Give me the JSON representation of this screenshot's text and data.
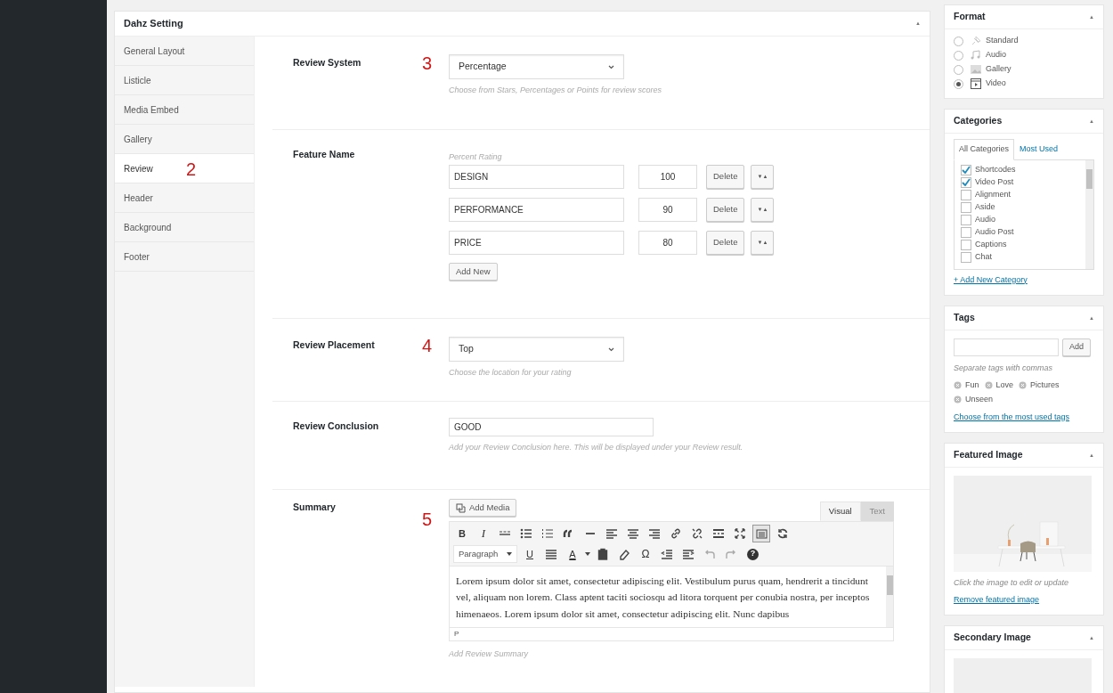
{
  "panel": {
    "title": "Dahz Setting",
    "collapse": "▲"
  },
  "tabs": [
    {
      "label": "General Layout",
      "selected": false
    },
    {
      "label": "Listicle",
      "selected": false
    },
    {
      "label": "Media Embed",
      "selected": false
    },
    {
      "label": "Gallery",
      "selected": false
    },
    {
      "label": "Review",
      "selected": true,
      "annotation": "2"
    },
    {
      "label": "Header",
      "selected": false
    },
    {
      "label": "Background",
      "selected": false
    },
    {
      "label": "Footer",
      "selected": false
    }
  ],
  "sections": [
    {
      "kind": "select",
      "label": "Review System",
      "annotation": "3",
      "value": "Percentage",
      "help": "Choose from Stars, Percentages or Points for review scores"
    },
    {
      "kind": "features",
      "label": "Feature Name",
      "caption": "Percent Rating",
      "rows": [
        {
          "name": "DESIGN",
          "score": "100",
          "delete": "Delete",
          "move": "▼▲"
        },
        {
          "name": "PERFORMANCE",
          "score": "90",
          "delete": "Delete",
          "move": "▼▲"
        },
        {
          "name": "PRICE",
          "score": "80",
          "delete": "Delete",
          "move": "▼▲"
        }
      ],
      "add_label": "Add New"
    },
    {
      "kind": "select",
      "label": "Review Placement",
      "annotation": "4",
      "value": "Top",
      "help": "Choose the location for your rating"
    },
    {
      "kind": "text",
      "label": "Review Conclusion",
      "value": "GOOD",
      "help": "Add your Review Conclusion here. This will be displayed under your Review result."
    },
    {
      "kind": "editor",
      "label": "Summary",
      "annotation": "5",
      "add_media": "Add Media",
      "tabs": [
        {
          "label": "Visual",
          "selected": true
        },
        {
          "label": "Text",
          "selected": false
        }
      ],
      "toolbar": {
        "bold": "B",
        "italic": "I",
        "format": "Paragraph",
        "underline": "U",
        "text_color": "A",
        "special_char": "Ω",
        "help": "?",
        "toggle_pressed": true
      },
      "content": "Lorem ipsum dolor sit amet, consectetur adipiscing elit. Vestibulum purus quam, hendrerit a tincidunt vel, aliquam non lorem. Class aptent taciti sociosqu ad litora torquent per conubia nostra, per inceptos himenaeos. Lorem ipsum dolor sit amet, consectetur adipiscing elit. Nunc dapibus",
      "path": "P",
      "help": "Add Review Summary"
    }
  ],
  "sidebar": {
    "format": {
      "title": "Format",
      "collapse": "▲",
      "options": [
        {
          "label": "Standard",
          "selected": false
        },
        {
          "label": "Audio",
          "selected": false
        },
        {
          "label": "Gallery",
          "selected": false
        },
        {
          "label": "Video",
          "selected": true
        }
      ]
    },
    "categories": {
      "title": "Categories",
      "collapse": "▲",
      "tabs": [
        {
          "label": "All Categories",
          "selected": true
        },
        {
          "label": "Most Used",
          "selected": false
        }
      ],
      "items": [
        {
          "label": "Shortcodes",
          "checked": true
        },
        {
          "label": "Video Post",
          "checked": true
        },
        {
          "label": "Alignment",
          "checked": false
        },
        {
          "label": "Aside",
          "checked": false
        },
        {
          "label": "Audio",
          "checked": false
        },
        {
          "label": "Audio Post",
          "checked": false
        },
        {
          "label": "Captions",
          "checked": false
        },
        {
          "label": "Chat",
          "checked": false
        }
      ],
      "add_link": "+ Add New Category"
    },
    "tags": {
      "title": "Tags",
      "collapse": "▲",
      "add": "Add",
      "hint": "Separate tags with commas",
      "tags": [
        "Fun",
        "Love",
        "Pictures",
        "Unseen"
      ],
      "link": "Choose from the most used tags"
    },
    "featured": {
      "title": "Featured Image",
      "collapse": "▲",
      "caption": "Click the image to edit or update",
      "link": "Remove featured image"
    },
    "secondary": {
      "title": "Secondary Image",
      "collapse": "▲"
    }
  }
}
